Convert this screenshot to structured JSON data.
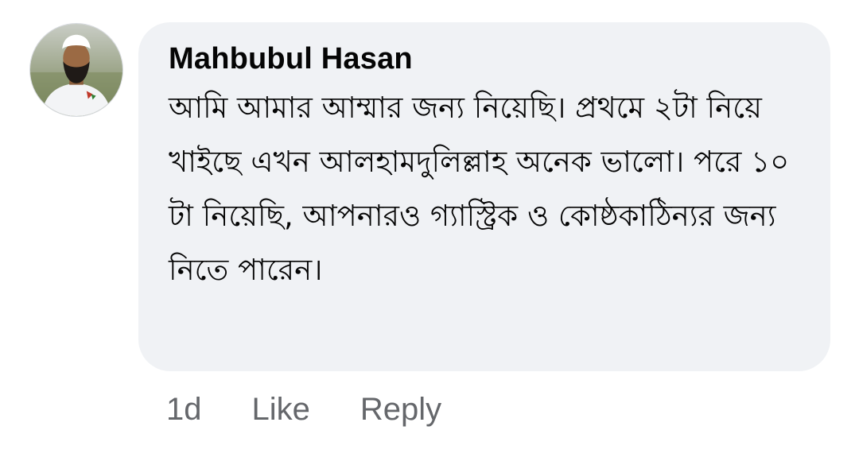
{
  "comment": {
    "author": "Mahbubul Hasan",
    "text": "আমি আমার আম্মার জন্য নিয়েছি। প্রথমে ২টা নিয়ে খাইছে এখন আলহামদুলিল্লাহ অনেক ভালো। পরে ১০ টা নিয়েছি, আপনারও গ্যাস্ট্রিক ও কোষ্ঠকাঠিন্যর জন্য নিতে পারেন।",
    "time": "1d",
    "like_label": "Like",
    "reply_label": "Reply"
  },
  "colors": {
    "bubble_bg": "#f0f2f5",
    "text": "#050505",
    "meta": "#65676b"
  }
}
